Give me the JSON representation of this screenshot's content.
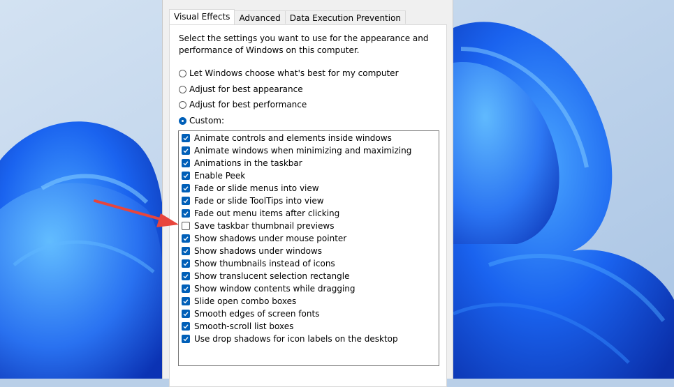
{
  "tabs": [
    {
      "label": "Visual Effects",
      "active": true
    },
    {
      "label": "Advanced",
      "active": false
    },
    {
      "label": "Data Execution Prevention",
      "active": false
    }
  ],
  "description": "Select the settings you want to use for the appearance and performance of Windows on this computer.",
  "radio_options": [
    {
      "label": "Let Windows choose what's best for my computer",
      "checked": false
    },
    {
      "label": "Adjust for best appearance",
      "checked": false
    },
    {
      "label": "Adjust for best performance",
      "checked": false
    },
    {
      "label": "Custom:",
      "checked": true
    }
  ],
  "effects": [
    {
      "label": "Animate controls and elements inside windows",
      "checked": true
    },
    {
      "label": "Animate windows when minimizing and maximizing",
      "checked": true
    },
    {
      "label": "Animations in the taskbar",
      "checked": true
    },
    {
      "label": "Enable Peek",
      "checked": true
    },
    {
      "label": "Fade or slide menus into view",
      "checked": true
    },
    {
      "label": "Fade or slide ToolTips into view",
      "checked": true
    },
    {
      "label": "Fade out menu items after clicking",
      "checked": true
    },
    {
      "label": "Save taskbar thumbnail previews",
      "checked": false
    },
    {
      "label": "Show shadows under mouse pointer",
      "checked": true
    },
    {
      "label": "Show shadows under windows",
      "checked": true
    },
    {
      "label": "Show thumbnails instead of icons",
      "checked": true
    },
    {
      "label": "Show translucent selection rectangle",
      "checked": true
    },
    {
      "label": "Show window contents while dragging",
      "checked": true
    },
    {
      "label": "Slide open combo boxes",
      "checked": true
    },
    {
      "label": "Smooth edges of screen fonts",
      "checked": true
    },
    {
      "label": "Smooth-scroll list boxes",
      "checked": true
    },
    {
      "label": "Use drop shadows for icon labels on the desktop",
      "checked": true
    }
  ],
  "colors": {
    "accent": "#005fb8",
    "arrow": "#e8453c",
    "wallpaper_blue": "#1e5ee8"
  },
  "icons": {
    "annotation": "red-arrow-icon",
    "checkmark": "checkmark-icon"
  }
}
